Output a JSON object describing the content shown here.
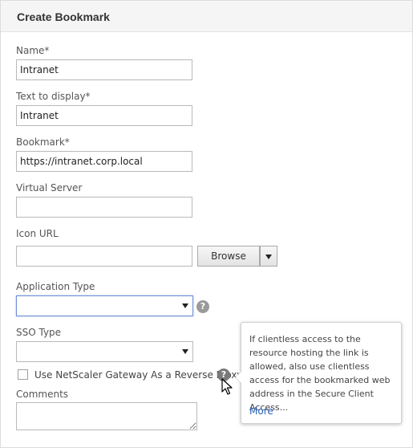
{
  "dialog": {
    "title": "Create Bookmark"
  },
  "fields": {
    "name": {
      "label": "Name*",
      "value": "Intranet"
    },
    "text_to_display": {
      "label": "Text to display*",
      "value": "Intranet"
    },
    "bookmark": {
      "label": "Bookmark*",
      "value": "https://intranet.corp.local"
    },
    "virtual_server": {
      "label": "Virtual Server",
      "value": ""
    },
    "icon_url": {
      "label": "Icon URL",
      "value": "",
      "browse_label": "Browse"
    },
    "application_type": {
      "label": "Application Type",
      "value": ""
    },
    "sso_type": {
      "label": "SSO Type",
      "value": ""
    },
    "reverse_proxy": {
      "label": "Use NetScaler Gateway As a Reverse Proxy",
      "checked": false
    },
    "comments": {
      "label": "Comments",
      "value": ""
    }
  },
  "tooltip": {
    "text": "If clientless access to the resource hosting the link is allowed, also use clientless access for the bookmarked web address in the Secure Client Access...",
    "more_label": "More"
  },
  "icons": {
    "help": "help-icon",
    "dropdown": "chevron-down-icon",
    "cursor": "mouse-pointer-icon"
  },
  "colors": {
    "header_bg": "#f5f5f5",
    "focus_border": "#6f8fd6",
    "link": "#2a63b3",
    "help_icon": "#9a9a9a"
  }
}
